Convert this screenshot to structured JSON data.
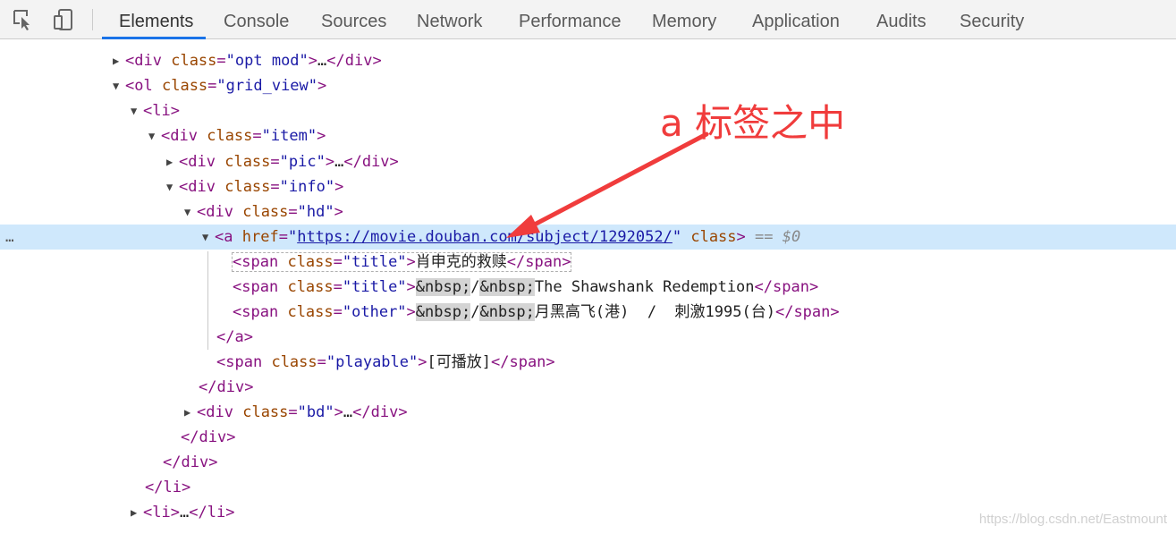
{
  "toolbar": {
    "icons": [
      "inspect-element-icon",
      "device-toggle-icon"
    ],
    "tabs": [
      {
        "label": "Elements",
        "active": true
      },
      {
        "label": "Console",
        "active": false
      },
      {
        "label": "Sources",
        "active": false
      },
      {
        "label": "Network",
        "active": false
      },
      {
        "label": "Performance",
        "active": false
      },
      {
        "label": "Memory",
        "active": false
      },
      {
        "label": "Application",
        "active": false
      },
      {
        "label": "Audits",
        "active": false
      },
      {
        "label": "Security",
        "active": false
      }
    ]
  },
  "tree": {
    "r1": {
      "tag": "div",
      "attr": "class",
      "val": "\"opt mod\"",
      "ell": "…",
      "close": "div"
    },
    "r2": {
      "tag": "ol",
      "attr": "class",
      "val": "\"grid_view\""
    },
    "r3": {
      "tag": "li"
    },
    "r4": {
      "tag": "div",
      "attr": "class",
      "val": "\"item\""
    },
    "r5": {
      "tag": "div",
      "attr": "class",
      "val": "\"pic\"",
      "ell": "…",
      "close": "div"
    },
    "r6": {
      "tag": "div",
      "attr": "class",
      "val": "\"info\""
    },
    "r7": {
      "tag": "div",
      "attr": "class",
      "val": "\"hd\""
    },
    "r8": {
      "tag": "a",
      "attr": "href",
      "url": "https://movie.douban.com/subject/1292052/",
      "attr2": "class",
      "eq": "== $0"
    },
    "r9": {
      "tag": "span",
      "attr": "class",
      "val": "\"title\"",
      "text": "肖申克的救赎",
      "close": "span"
    },
    "r10": {
      "tag": "span",
      "attr": "class",
      "val": "\"title\"",
      "ent1": "&nbsp;",
      "slash": "/",
      "ent2": "&nbsp;",
      "text": "The Shawshank Redemption",
      "close": "span"
    },
    "r11": {
      "tag": "span",
      "attr": "class",
      "val": "\"other\"",
      "ent1": "&nbsp;",
      "slash": "/",
      "ent2": "&nbsp;",
      "text": "月黑高飞(港)  /  刺激1995(台)",
      "close": "span"
    },
    "r12": {
      "close": "a"
    },
    "r13": {
      "tag": "span",
      "attr": "class",
      "val": "\"playable\"",
      "text": "[可播放]",
      "close": "span"
    },
    "r14": {
      "close": "div"
    },
    "r15": {
      "tag": "div",
      "attr": "class",
      "val": "\"bd\"",
      "ell": "…",
      "close": "div"
    },
    "r16": {
      "close": "div"
    },
    "r17": {
      "close": "div"
    },
    "r18": {
      "close": "li"
    },
    "r19": {
      "tag": "li",
      "ell": "…",
      "close": "li"
    },
    "row_menu": "…"
  },
  "annotation": {
    "label": "a 标签之中",
    "color": "#f03c3c"
  },
  "watermark": "https://blog.csdn.net/Eastmount"
}
